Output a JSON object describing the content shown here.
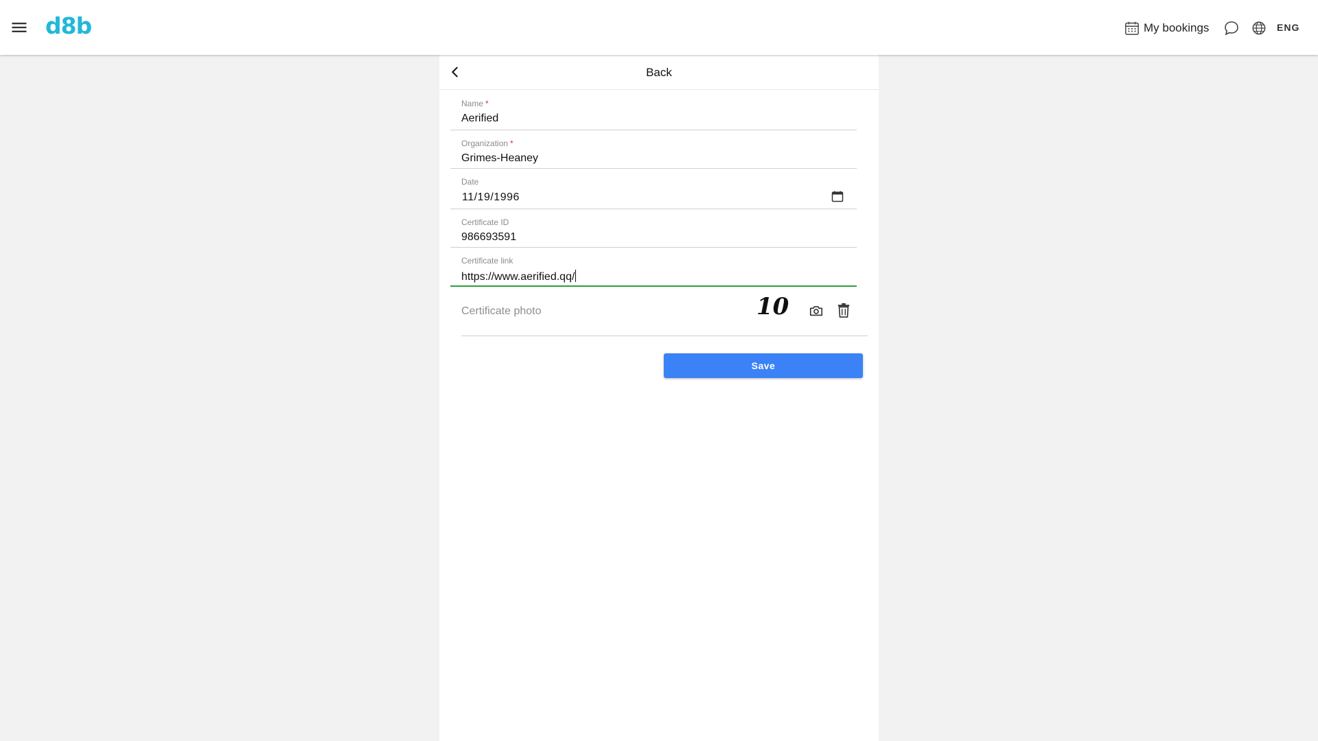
{
  "header": {
    "logo": "d8b",
    "bookings_label": "My bookings",
    "language": "ENG",
    "icons": [
      "menu-icon",
      "calendar-icon",
      "chat-icon",
      "globe-icon"
    ]
  },
  "nav": {
    "back_label": "Back"
  },
  "form": {
    "name": {
      "label": "Name",
      "required_mark": "*",
      "value": "Aerified"
    },
    "organization": {
      "label": "Organization",
      "required_mark": "*",
      "value": "Grimes-Heaney"
    },
    "date": {
      "label": "Date",
      "value": "11/19/1996"
    },
    "certificate_id": {
      "label": "Certificate ID",
      "value": "986693591"
    },
    "certificate_link": {
      "label": "Certificate link",
      "value": "https://www.aerified.qq/"
    },
    "certificate_photo": {
      "label": "Certificate photo",
      "thumbnail_text": "10"
    },
    "save_label": "Save"
  },
  "colors": {
    "brand": "#22b8d8",
    "primary_button": "#3b82f6",
    "focus_underline": "#2e9e3c",
    "required": "#e03030",
    "background": "#f2f2f2"
  }
}
